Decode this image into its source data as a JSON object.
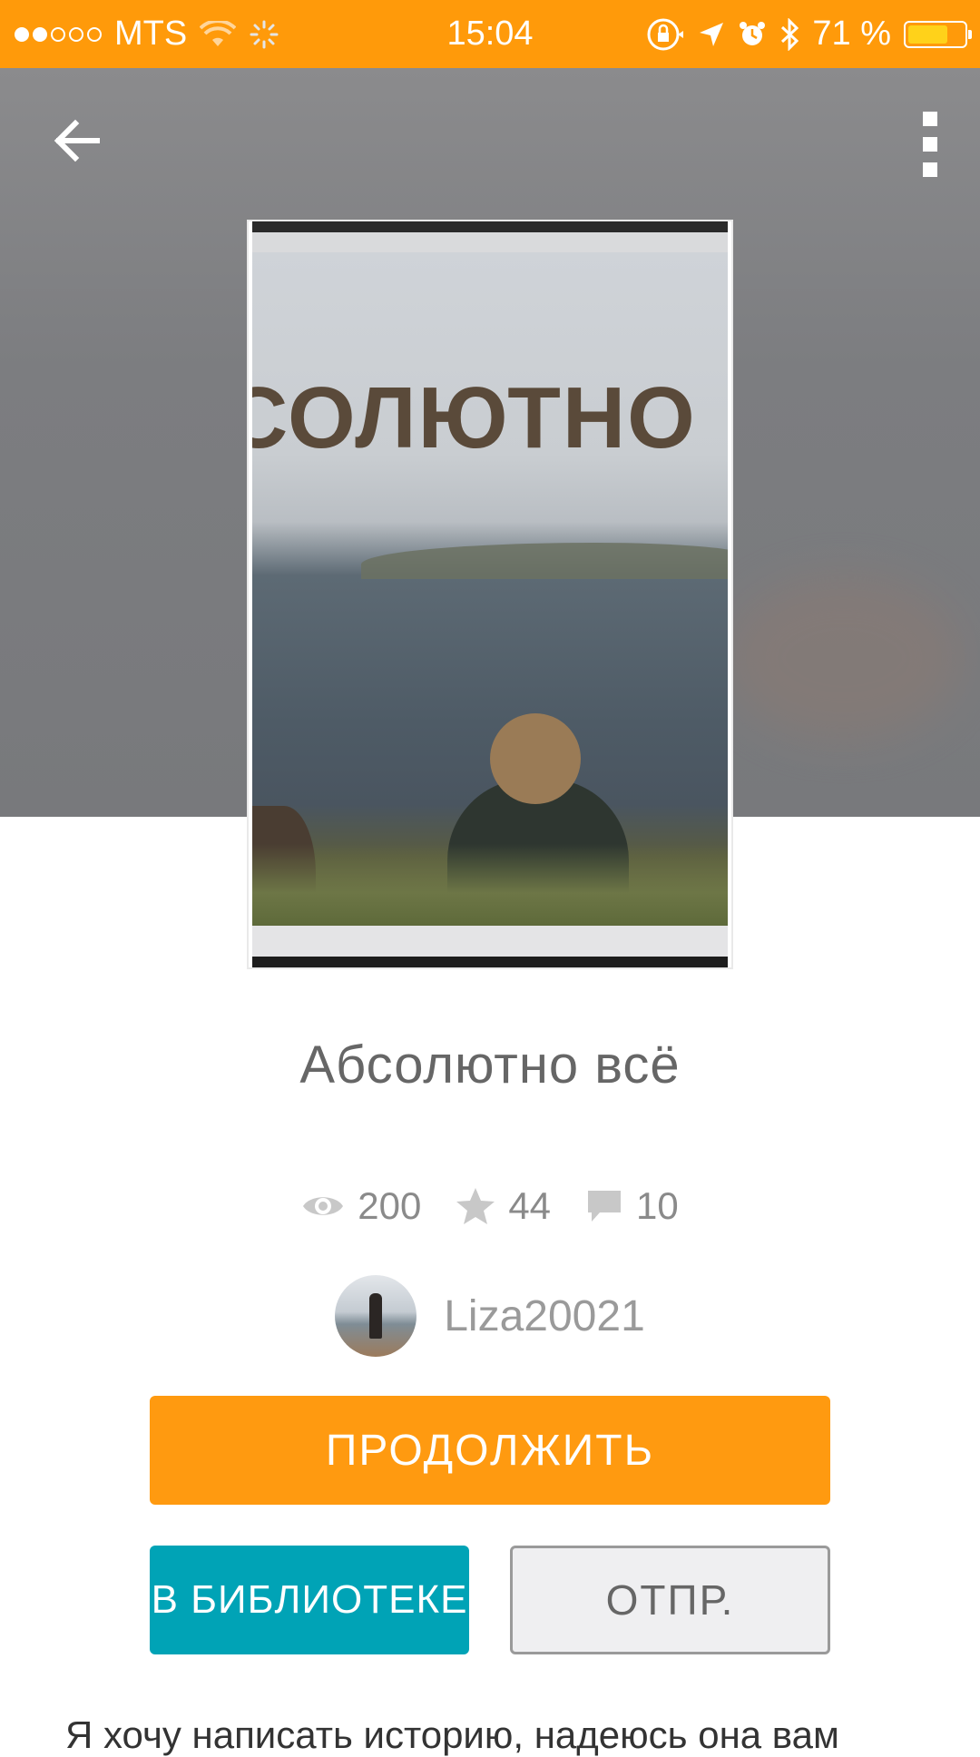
{
  "status_bar": {
    "carrier": "MTS",
    "time": "15:04",
    "battery": "71 %",
    "battery_level": 0.71,
    "signal_bars_filled": 2,
    "signal_bars_total": 5
  },
  "header": {
    "back_icon": "arrow-left-icon",
    "menu_icon": "more-vertical-icon"
  },
  "cover": {
    "title_text": "СОЛЮТНО"
  },
  "book": {
    "title": "Абсолютно всё",
    "stats": {
      "views": "200",
      "votes": "44",
      "comments": "10"
    },
    "author": "Liza20021"
  },
  "actions": {
    "continue_label": "ПРОДОЛЖИТЬ",
    "library_label": "В БИБЛИОТЕКЕ",
    "send_label": "ОТПР."
  },
  "description": "Я хочу написать историю, надеюсь она вам",
  "colors": {
    "accent": "#ff9a0a",
    "library": "#00a3b6"
  }
}
